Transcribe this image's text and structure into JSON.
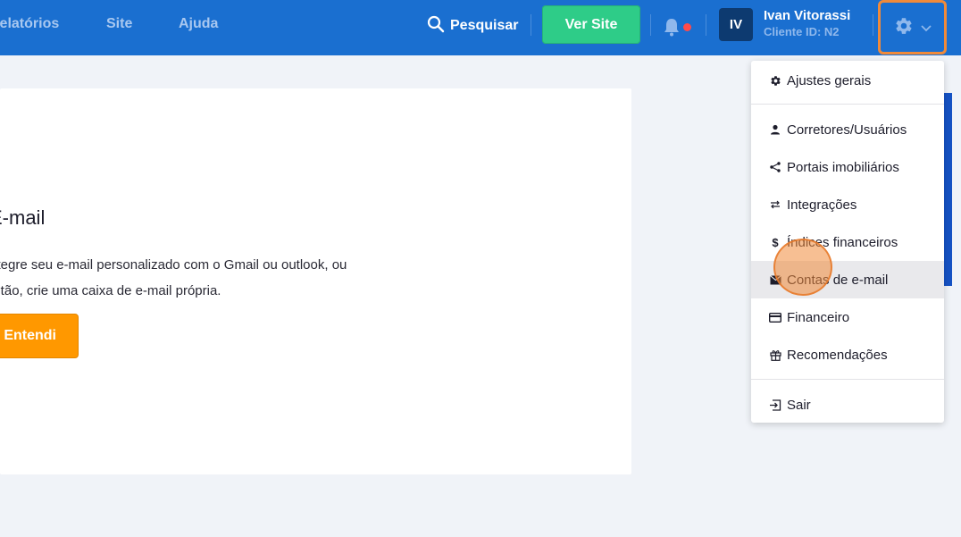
{
  "topbar": {
    "nav": [
      "Relatórios",
      "Site",
      "Ajuda"
    ],
    "search_label": "Pesquisar",
    "view_site_label": "Ver Site",
    "user": {
      "initials": "IV",
      "name": "Ivan Vitorassi",
      "client_id": "Cliente ID: N2"
    }
  },
  "card": {
    "title": "E-mail",
    "text_line1": "Integre seu e-mail personalizado com o Gmail ou outlook, ou",
    "text_line2": "então, crie uma caixa de e-mail própria.",
    "button_label": "Entendi"
  },
  "dropdown": {
    "items": [
      {
        "label": "Ajustes gerais",
        "icon": "gear-icon"
      },
      {
        "label": "Corretores/Usuários",
        "icon": "user-icon"
      },
      {
        "label": "Portais imobiliários",
        "icon": "share-icon"
      },
      {
        "label": "Integrações",
        "icon": "arrows-icon"
      },
      {
        "label": "Índices financeiros",
        "icon": "dollar-icon"
      },
      {
        "label": "Contas de e-mail",
        "icon": "envelope-icon"
      },
      {
        "label": "Financeiro",
        "icon": "credit-card-icon"
      },
      {
        "label": "Recomendações",
        "icon": "gift-icon"
      },
      {
        "label": "Sair",
        "icon": "logout-icon"
      }
    ],
    "active_index": 5
  },
  "colors": {
    "topbar": "#1a6fd0",
    "view_site_button": "#2ecc88",
    "primary_button": "#ff9800",
    "highlight": "#f08a3a",
    "notification_dot": "#ff4a4a"
  }
}
